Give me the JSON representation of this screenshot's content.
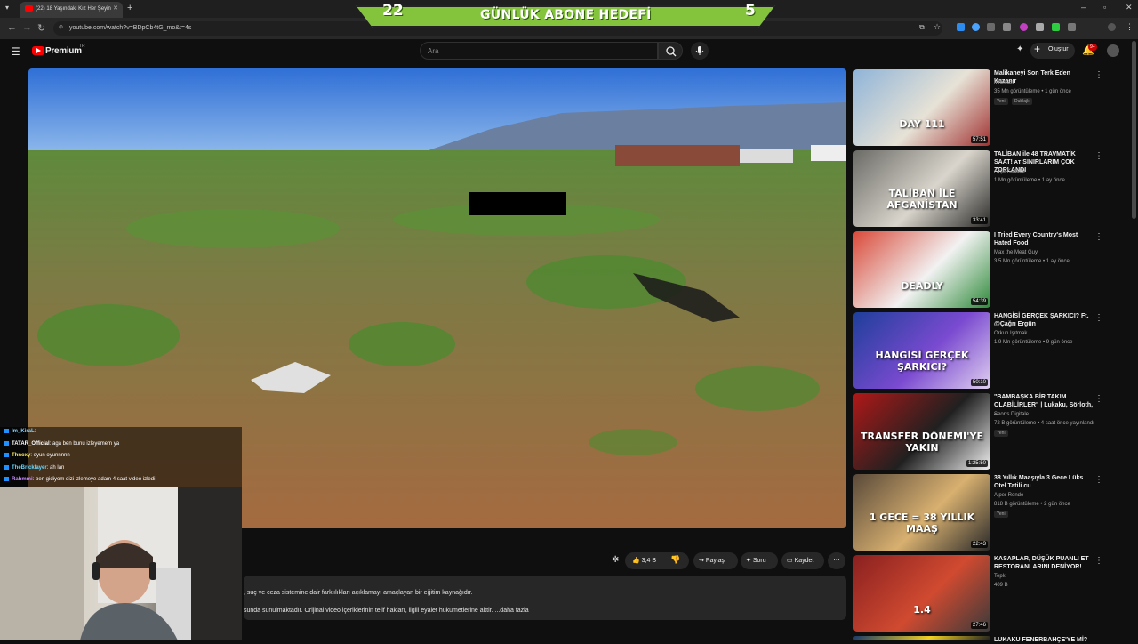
{
  "browser": {
    "tab_title": "(22) 18 Yaşındaki Kız Her Şeyin",
    "new_tab": "+",
    "url": "youtube.com/watch?v=BDpCb4tG_mo&t=4s"
  },
  "overlay": {
    "left_count": "22",
    "title": "GÜNLÜK ABONE HEDEFİ",
    "right_count": "5"
  },
  "header": {
    "logo_text": "Premium",
    "logo_region": "TR",
    "search_placeholder": "Ara",
    "create_label": "Oluştur",
    "notif_badge": "9+"
  },
  "chat": [
    {
      "user": "Im_KiraL",
      "text": ": ",
      "color": "#7fd1ff"
    },
    {
      "user": "TATAR_Official",
      "text": ": aga ben bunu izleyemem ya",
      "color": "#ffffff"
    },
    {
      "user": "Thnoxy",
      "text": ": oyun oyunnnnn",
      "color": "#f5e663"
    },
    {
      "user": "TheBricklayer",
      "text": ": ah lan",
      "color": "#66d9ff"
    },
    {
      "user": "Rahmmi",
      "text": ": ben gidiyom dizi izlemeye adam 4 saat video izledi",
      "color": "#c78cff"
    }
  ],
  "actions": {
    "likes": "3,4 B",
    "share": "Paylaş",
    "ask": "Soru",
    "save": "Kaydet",
    "more": "⋯"
  },
  "description": {
    "line1": ", suç ve ceza sistemine dair farklılıkları açıklamayı amaçlayan bir eğitim kaynağıdır.",
    "line2": "sunda sunulmaktadır. Orijinal video içeriklerinin telif hakları, ilgili eyalet hükümetlerine aittir. ...daha fazla"
  },
  "recommendations": [
    {
      "title": "Malikaneyi Son Terk Eden Kazanır",
      "channel": "MrBeast",
      "meta": "35 Mn görüntüleme • 1 gün önce",
      "badges": [
        "Yeni",
        "Dublajlı"
      ],
      "duration": "57:51",
      "overlay_text": "DAY 111",
      "colors": [
        "#8fb4d8",
        "#e7e2d6",
        "#a03030"
      ]
    },
    {
      "title": "TALİBAN ile 48 TRAVMATİK SAAT! ᴀᴛ SINIRLARIM ÇOK ZORLANDI",
      "channel": "Ayşe Kocalar",
      "meta": "1 Mn görüntüleme • 1 ay önce",
      "badges": [],
      "duration": "33:41",
      "overlay_text": "TALİBAN İLE AFGANİSTAN",
      "colors": [
        "#6b6b66",
        "#d9d5cc",
        "#2a2a28"
      ]
    },
    {
      "title": "I Tried Every Country's Most Hated Food",
      "channel": "Max the Meat Guy",
      "meta": "3,5 Mn görüntüleme • 1 ay önce",
      "badges": [],
      "duration": "54:39",
      "overlay_text": "DEADLY",
      "colors": [
        "#d94a3a",
        "#f2f2f2",
        "#2f8a3a"
      ]
    },
    {
      "title": "HANGİSİ GERÇEK ŞARKICI? Ft. @Çağrı Ergün",
      "channel": "Orkun Işıtmak",
      "meta": "1,9 Mn görüntüleme • 9 gün önce",
      "badges": [],
      "duration": "50:10",
      "overlay_text": "HANGİSİ GERÇEK ŞARKICI?",
      "colors": [
        "#1e3f9a",
        "#7a4ad0",
        "#e0d0f0"
      ]
    },
    {
      "title": "\"BAMBAŞKA BİR TAKIM OLABİLİRLER\" | Lukaku, Sörloth, ...",
      "channel": "Sports Digitale",
      "meta": "72 B görüntüleme • 4 saat önce yayınlandı",
      "badges": [
        "Yeni"
      ],
      "duration": "1:25:50",
      "overlay_text": "TRANSFER DÖNEMİ'YE YAKIN",
      "colors": [
        "#b01818",
        "#202020",
        "#f0f0f0"
      ]
    },
    {
      "title": "38 Yıllık Maaşıyla 3 Gece Lüks Otel Tatili cu",
      "channel": "Alper Rende",
      "meta": "818 B görüntüleme • 2 gün önce",
      "badges": [
        "Yeni"
      ],
      "duration": "22:43",
      "overlay_text": "1 GECE = 38 YILLIK MAAŞ",
      "colors": [
        "#5a4a3a",
        "#d8b070",
        "#2a2a2a"
      ]
    },
    {
      "title": "KASAPLAR, DÜŞÜK PUANLI ET RESTORANLARINI DENİYOR!",
      "channel": "Tepki",
      "meta": "409 B",
      "badges": [],
      "duration": "27:46",
      "overlay_text": "1.4",
      "colors": [
        "#8a2020",
        "#d04a30",
        "#3a3a3a"
      ]
    },
    {
      "title": "LUKAKU FENERBAHÇE'YE Mİ?",
      "channel": "",
      "meta": "",
      "badges": [],
      "duration": "",
      "overlay_text": "",
      "colors": [
        "#1a3a6a",
        "#f0d020",
        "#202020"
      ]
    }
  ]
}
